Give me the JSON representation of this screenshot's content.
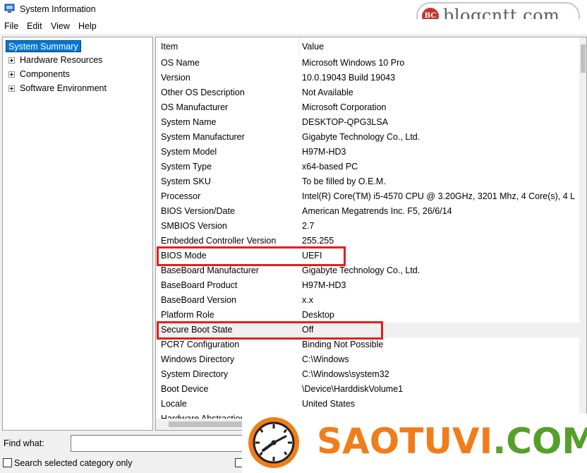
{
  "window": {
    "title": "System Information"
  },
  "menu": [
    "File",
    "Edit",
    "View",
    "Help"
  ],
  "tree": {
    "root": "System Summary",
    "children": [
      "Hardware Resources",
      "Components",
      "Software Environment"
    ]
  },
  "list": {
    "headers": {
      "item": "Item",
      "value": "Value"
    },
    "rows": [
      {
        "item": "OS Name",
        "value": "Microsoft Windows 10 Pro"
      },
      {
        "item": "Version",
        "value": "10.0.19043 Build 19043"
      },
      {
        "item": "Other OS Description",
        "value": "Not Available"
      },
      {
        "item": "OS Manufacturer",
        "value": "Microsoft Corporation"
      },
      {
        "item": "System Name",
        "value": "DESKTOP-QPG3LSA"
      },
      {
        "item": "System Manufacturer",
        "value": "Gigabyte Technology Co., Ltd."
      },
      {
        "item": "System Model",
        "value": "H97M-HD3"
      },
      {
        "item": "System Type",
        "value": "x64-based PC"
      },
      {
        "item": "System SKU",
        "value": "To be filled by O.E.M."
      },
      {
        "item": "Processor",
        "value": "Intel(R) Core(TM) i5-4570 CPU @ 3.20GHz, 3201 Mhz, 4 Core(s), 4 L"
      },
      {
        "item": "BIOS Version/Date",
        "value": "American Megatrends Inc. F5, 26/6/14"
      },
      {
        "item": "SMBIOS Version",
        "value": "2.7"
      },
      {
        "item": "Embedded Controller Version",
        "value": "255.255"
      },
      {
        "item": "BIOS Mode",
        "value": "UEFI"
      },
      {
        "item": "BaseBoard Manufacturer",
        "value": "Gigabyte Technology Co., Ltd."
      },
      {
        "item": "BaseBoard Product",
        "value": "H97M-HD3"
      },
      {
        "item": "BaseBoard Version",
        "value": "x.x"
      },
      {
        "item": "Platform Role",
        "value": "Desktop"
      },
      {
        "item": "Secure Boot State",
        "value": "Off"
      },
      {
        "item": "PCR7 Configuration",
        "value": "Binding Not Possible"
      },
      {
        "item": "Windows Directory",
        "value": "C:\\Windows"
      },
      {
        "item": "System Directory",
        "value": "C:\\Windows\\system32"
      },
      {
        "item": "Boot Device",
        "value": "\\Device\\HarddiskVolume1"
      },
      {
        "item": "Locale",
        "value": "United States"
      },
      {
        "item": "Hardware Abstraction Layer",
        "value": ""
      }
    ],
    "selected_row": "Secure Boot State",
    "highlighted_rows": [
      "BIOS Mode",
      "Secure Boot State"
    ]
  },
  "find": {
    "label": "Find what:",
    "value": "",
    "search_selected_label": "Search selected category only"
  },
  "watermarks": {
    "top": {
      "badge": "BC",
      "text": "blogcntt.com"
    },
    "bottom": {
      "brand": "SAOTUVI",
      "suffix": ".COM"
    }
  },
  "colors": {
    "selection": "#0078d7",
    "highlight_box": "#e02020",
    "brand_orange": "#f07d1a",
    "brand_green": "#55a02a"
  }
}
